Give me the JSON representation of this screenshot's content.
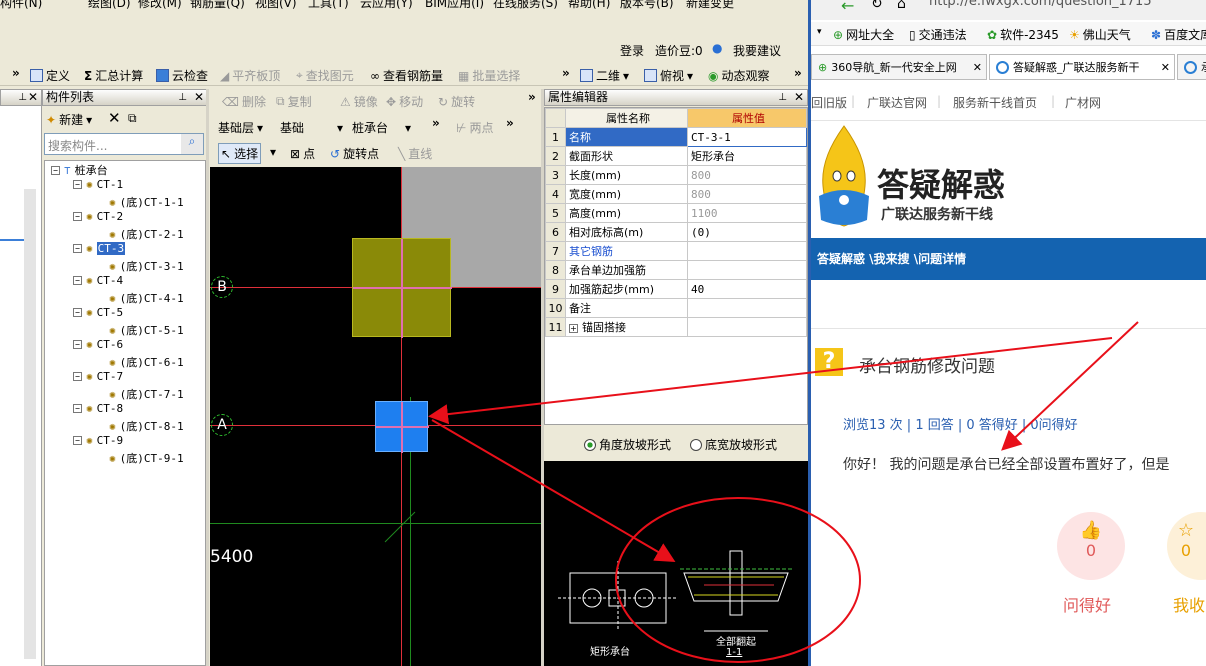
{
  "menu": [
    "构件(N)",
    "绘图(D)",
    "修改(M)",
    "钢筋量(Q)",
    "视图(V)",
    "工具(T)",
    "云应用(Y)",
    "BIM应用(I)",
    "在线服务(S)",
    "帮助(H)",
    "版本号(B)",
    "新建变更"
  ],
  "account": {
    "login": "登录",
    "beans": "造价豆:0",
    "suggest": "我要建议"
  },
  "toolbar1": [
    "定义",
    "汇总计算",
    "云检查",
    "平齐板顶",
    "查找图元",
    "查看钢筋量",
    "批量选择",
    "二维",
    "俯视",
    "动态观察"
  ],
  "toolbar2": [
    "删除",
    "复制",
    "镜像",
    "移动",
    "旋转"
  ],
  "layer": {
    "floor": "基础层",
    "category": "基础",
    "type": "桩承台",
    "point": "两点"
  },
  "toolbar3": [
    "选择",
    "点",
    "旋转点",
    "直线"
  ],
  "component_panel": {
    "title": "构件列表",
    "new": "新建",
    "search_placeholder": "搜索构件..."
  },
  "tree": {
    "root": "桩承台",
    "items": [
      {
        "name": "CT-1",
        "child": "(底)CT-1-1"
      },
      {
        "name": "CT-2",
        "child": "(底)CT-2-1"
      },
      {
        "name": "CT-3",
        "child": "(底)CT-3-1"
      },
      {
        "name": "CT-4",
        "child": "(底)CT-4-1"
      },
      {
        "name": "CT-5",
        "child": "(底)CT-5-1"
      },
      {
        "name": "CT-6",
        "child": "(底)CT-6-1"
      },
      {
        "name": "CT-7",
        "child": "(底)CT-7-1"
      },
      {
        "name": "CT-8",
        "child": "(底)CT-8-1"
      },
      {
        "name": "CT-9",
        "child": "(底)CT-9-1"
      }
    ],
    "selected": "CT-3"
  },
  "cad": {
    "axis_b": "B",
    "axis_a": "A",
    "dimension": "5400"
  },
  "property_editor": {
    "title": "属性编辑器",
    "col_name": "属性名称",
    "col_value": "属性值",
    "rows": [
      {
        "n": "1",
        "name": "名称",
        "value": "CT-3-1"
      },
      {
        "n": "2",
        "name": "截面形状",
        "value": "矩形承台"
      },
      {
        "n": "3",
        "name": "长度(mm)",
        "value": "800"
      },
      {
        "n": "4",
        "name": "宽度(mm)",
        "value": "800"
      },
      {
        "n": "5",
        "name": "高度(mm)",
        "value": "1100"
      },
      {
        "n": "6",
        "name": "相对底标高(m)",
        "value": "(0)"
      },
      {
        "n": "7",
        "name": "其它钢筋",
        "value": ""
      },
      {
        "n": "8",
        "name": "承台单边加强筋",
        "value": ""
      },
      {
        "n": "9",
        "name": "加强筋起步(mm)",
        "value": "40"
      },
      {
        "n": "10",
        "name": "备注",
        "value": ""
      },
      {
        "n": "11",
        "name": "锚固搭接",
        "value": ""
      }
    ]
  },
  "slope": {
    "option1": "角度放坡形式",
    "option2": "底宽放坡形式"
  },
  "preview": {
    "label_left": "矩形承台",
    "label_right": "全部翻起",
    "section": "1-1"
  },
  "browser": {
    "url": "http://e.fwxgx.com/question_1715",
    "favorites": [
      "网址大全",
      "交通违法",
      "软件-2345",
      "佛山天气",
      "百度文库"
    ],
    "tabs": [
      "360导航_新一代安全上网",
      "答疑解惑_广联达服务新干",
      "承"
    ],
    "sitenav": [
      "回旧版",
      "广联达官网",
      "服务新干线首页",
      "广材网"
    ],
    "logo_title": "答疑解惑",
    "logo_subtitle": "广联达服务新干线",
    "breadcrumb": "答疑解惑 \\我来搜 \\问题详情",
    "question_title": "承台钢筋修改问题",
    "stats": "浏览13 次 | 1 回答 | 0 答得好 | 0问得好",
    "question_body": "你好！ 我的问题是承台已经全部设置布置好了，但是",
    "good_count": "0",
    "good_label": "问得好",
    "fav_count": "0",
    "fav_label": "我收"
  }
}
